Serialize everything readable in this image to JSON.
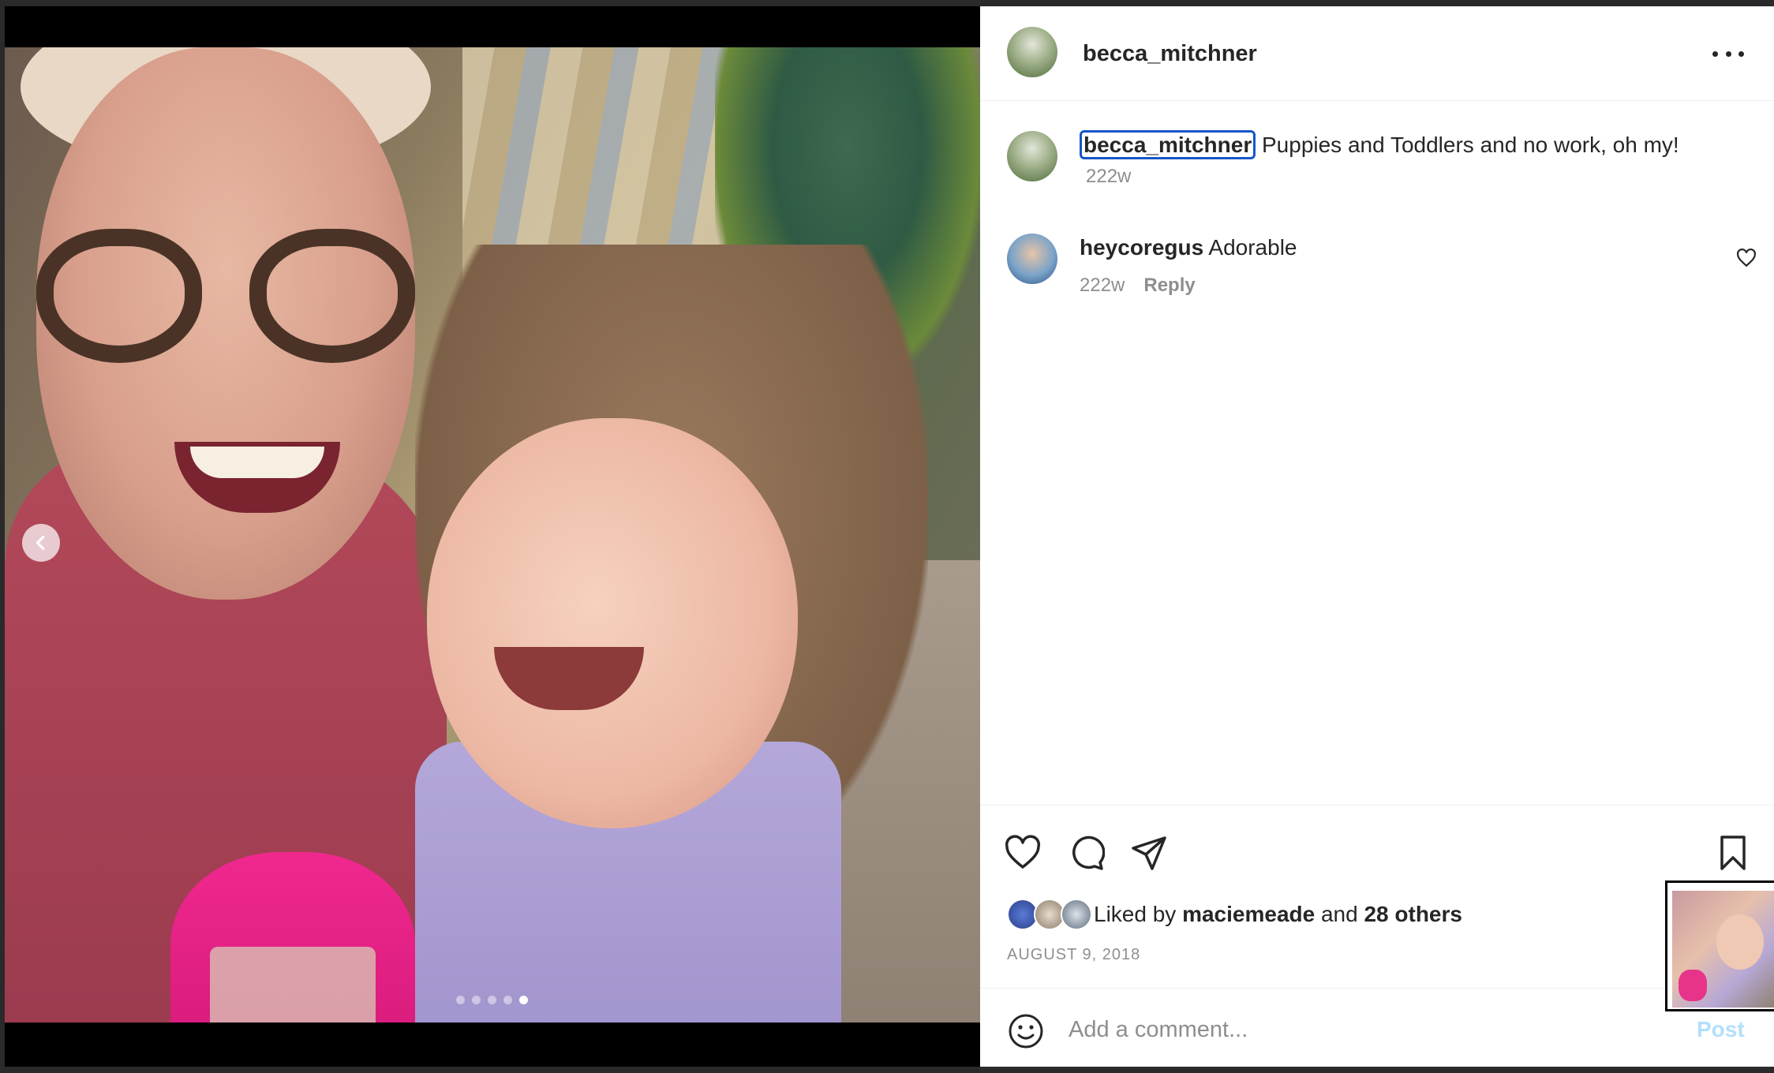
{
  "post": {
    "username": "becca_mitchner",
    "caption_user": "becca_mitchner",
    "caption_text": "Puppies and Toddlers and no work, oh my!",
    "caption_time": "222w",
    "date": "AUGUST 9, 2018"
  },
  "carousel": {
    "dot_count": 5,
    "active_index": 5
  },
  "comments": [
    {
      "user": "heycoregus",
      "text": "Adorable",
      "time": "222w",
      "reply_label": "Reply"
    }
  ],
  "likes": {
    "prefix": "Liked by",
    "user": "maciemeade",
    "conjunction": "and",
    "others": "28 others"
  },
  "add_comment": {
    "placeholder": "Add a comment...",
    "post_label": "Post"
  },
  "icons": {
    "more": "more-options-icon",
    "prev": "chevron-left-icon",
    "like": "heart-icon",
    "comment": "comment-icon",
    "share": "send-icon",
    "save": "bookmark-icon",
    "emoji": "emoji-icon"
  },
  "colors": {
    "accent_blue": "#0095f6",
    "post_disabled": "#b2dffc",
    "focus_outline": "#1456c7",
    "text_primary": "#262626",
    "text_secondary": "#8e8e8e"
  }
}
